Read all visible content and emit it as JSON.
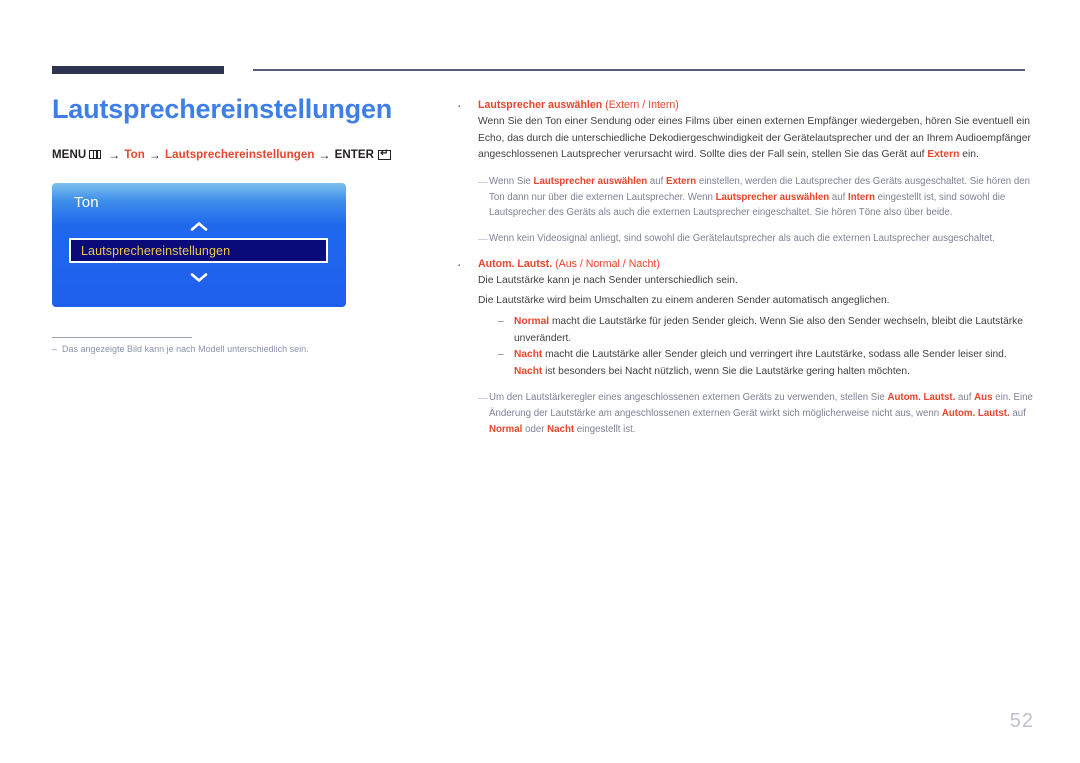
{
  "document": {
    "page_number": "52",
    "page_title": "Lautsprechereinstellungen"
  },
  "menu_path": {
    "menu_label": "MENU",
    "menu_icon": "menu-grid-icon",
    "arrow": "→",
    "step1": "Ton",
    "step2": "Lautsprechereinstellungen",
    "enter_label": "ENTER",
    "enter_icon": "enter-key-icon"
  },
  "osd": {
    "title": "Ton",
    "chevron_up": "chevron-up-icon",
    "chevron_down": "chevron-down-icon",
    "selected_item": "Lautsprechereinstellungen",
    "colors": {
      "gradient_top": "#7fc0f0",
      "gradient_bottom": "#1f5fec",
      "selected_bg": "#0a0a7a",
      "selected_text": "#e8c84a"
    }
  },
  "footnote": {
    "dash": "–",
    "text": "Das angezeigte Bild kann je nach Modell unterschiedlich sein."
  },
  "content": {
    "section1": {
      "heading_main": "Lautsprecher auswählen ",
      "heading_options": "(Extern / Intern)",
      "paragraph_1": "Wenn Sie den Ton einer Sendung oder eines Films über einen externen Empfänger wiedergeben, hören Sie eventuell ein Echo, das durch die unterschiedliche Dekodiergeschwindigkeit der Gerätelautsprecher und der an Ihrem Audioempfänger angeschlossenen Lautsprecher verursacht wird. Sollte dies der Fall sein, stellen Sie das Gerät auf ",
      "paragraph_1_bold": "Extern",
      "paragraph_1_end": " ein.",
      "note_1_a": "Wenn Sie ",
      "note_1_b": "Lautsprecher auswählen",
      "note_1_c": " auf ",
      "note_1_d": "Extern",
      "note_1_e": " einstellen, werden die Lautsprecher des Geräts ausgeschaltet. Sie hören den Ton dann nur über die externen Lautsprecher. Wenn ",
      "note_1_f": "Lautsprecher auswählen",
      "note_1_g": " auf ",
      "note_1_h": "Intern",
      "note_1_i": " eingestellt ist, sind sowohl die Lautsprecher des Geräts als auch die externen Lautsprecher eingeschaltet. Sie hören Töne also über beide.",
      "note_2": "Wenn kein Videosignal anliegt, sind sowohl die Gerätelautsprecher als auch die externen Lautsprecher ausgeschaltet."
    },
    "section2": {
      "heading_main": "Autom. Lautst. ",
      "heading_options": "(Aus / Normal / Nacht)",
      "paragraph_1": "Die Lautstärke kann je nach Sender unterschiedlich sein.",
      "paragraph_2": "Die Lautstärke wird beim Umschalten zu einem anderen Sender automatisch angeglichen.",
      "dash_lead": "–",
      "sub_1_bold": "Normal",
      "sub_1_text": " macht die Lautstärke für jeden Sender gleich. Wenn Sie also den Sender wechseln, bleibt die Lautstärke unverändert.",
      "sub_2_bold_a": "Nacht",
      "sub_2_text_a": " macht die Lautstärke aller Sender gleich und verringert ihre Lautstärke, sodass alle Sender leiser sind. ",
      "sub_2_bold_b": "Nacht",
      "sub_2_text_b": " ist besonders bei Nacht nützlich, wenn Sie die Lautstärke gering halten möchten.",
      "note_a": "Um den Lautstärkeregler eines angeschlossenen externen Geräts zu verwenden, stellen Sie ",
      "note_b": "Autom. Lautst.",
      "note_c": " auf ",
      "note_d": "Aus",
      "note_e": " ein. Eine Änderung der Lautstärke am angeschlossenen externen Gerät wirkt sich möglicherweise nicht aus, wenn ",
      "note_f": "Autom. Lautst.",
      "note_g": " auf ",
      "note_h": "Normal",
      "note_i": " oder ",
      "note_j": "Nacht",
      "note_k": " eingestellt ist."
    }
  }
}
